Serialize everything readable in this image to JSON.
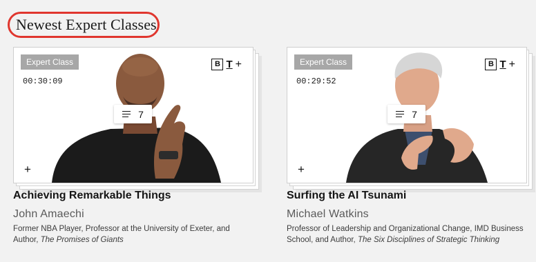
{
  "section": {
    "title": "Newest Expert Classes",
    "highlight_color": "#e0362e"
  },
  "cards": [
    {
      "badge": "Expert Class",
      "duration": "00:30:09",
      "brand": {
        "box_letter": "B",
        "letter": "T",
        "plus": "+"
      },
      "playlist_count": "7",
      "playlist_icon": "playlist-icon",
      "add_label": "+",
      "title": "Achieving Remarkable Things",
      "author": "John Amaechi",
      "desc_text": "Former NBA Player, Professor at the University of Exeter, and Author, ",
      "desc_italic": "The Promises of Giants"
    },
    {
      "badge": "Expert Class",
      "duration": "00:29:52",
      "brand": {
        "box_letter": "B",
        "letter": "T",
        "plus": "+"
      },
      "playlist_count": "7",
      "playlist_icon": "playlist-icon",
      "add_label": "+",
      "title": "Surfing the AI Tsunami",
      "author": "Michael Watkins",
      "desc_text": "Professor of Leadership and Organizational Change, IMD Business School, and Author, ",
      "desc_italic": "The Six Disciplines of Strategic Thinking"
    }
  ]
}
